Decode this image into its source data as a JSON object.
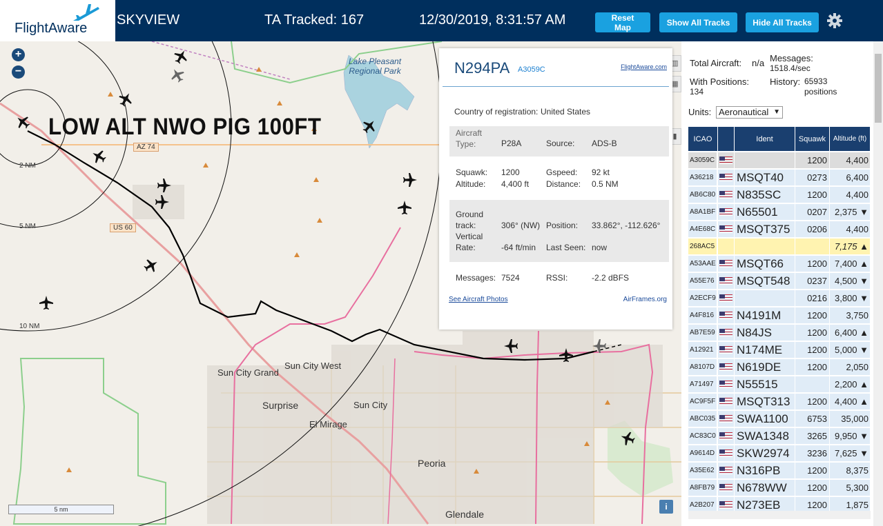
{
  "header": {
    "brand": "FlightAware",
    "app_title": "SKYVIEW",
    "tracked": "TA Tracked: 167",
    "datetime": "12/30/2019, 8:31:57 AM",
    "reset_map": "Reset Map",
    "show_all_tracks": "Show All Tracks",
    "hide_all_tracks": "Hide All Tracks",
    "settings_icon": "gear-icon"
  },
  "map": {
    "zoom_in": "+",
    "zoom_out": "−",
    "overlay_title": "LOW ALT NWO PIG 100FT",
    "scale_label": "5 nm",
    "info": "i",
    "range_rings": [
      "2 NM",
      "5 NM",
      "10 NM"
    ],
    "labels": {
      "lake": "Lake Pleasant Regional Park",
      "az74": "AZ 74",
      "us60": "US 60",
      "sun_city_west": "Sun City West",
      "sun_city_grand": "Sun City Grand",
      "surprise": "Surprise",
      "sun_city": "Sun City",
      "el_mirage": "El Mirage",
      "peoria": "Peoria",
      "glendale": "Glendale"
    },
    "colors": {
      "background": "#f2efe9",
      "track": "#000000",
      "highway": "#e8a0a0",
      "water": "#aad3df"
    }
  },
  "popup": {
    "registration": "N294PA",
    "icao": "A3059C",
    "link": "FlightAware.com",
    "country_label": "Country of registration:",
    "country": "United States",
    "aircraft_type_label": "Aircraft Type:",
    "aircraft_type": "P28A",
    "source_label": "Source:",
    "source": "ADS-B",
    "squawk_label": "Squawk:",
    "squawk": "1200",
    "gspeed_label": "Gspeed:",
    "gspeed": "92 kt",
    "altitude_label": "Altitude:",
    "altitude": "4,400 ft",
    "distance_label": "Distance:",
    "distance": "0.5 NM",
    "ground_track_label": "Ground track:",
    "ground_track": "306° (NW)",
    "position_label": "Position:",
    "position": "33.862°, -112.626°",
    "vertical_rate_label": "Vertical Rate:",
    "vertical_rate": "-64 ft/min",
    "last_seen_label": "Last Seen:",
    "last_seen": "now",
    "messages_label": "Messages:",
    "messages": "7524",
    "rssi_label": "RSSI:",
    "rssi": "-2.2 dBFS",
    "photos_link": "See Aircraft Photos",
    "airframes_link": "AirFrames.org"
  },
  "panel": {
    "total_aircraft_label": "Total Aircraft:",
    "total_aircraft": "n/a",
    "messages_label": "Messages:",
    "messages": "1518.4/sec",
    "with_positions_label": "With Positions:",
    "with_positions": "134",
    "history_label": "History:",
    "history": "65933 positions",
    "units_label": "Units:",
    "units_value": "Aeronautical",
    "columns": [
      "ICAO",
      "Ident",
      "Squawk",
      "Altitude (ft)"
    ],
    "rows": [
      {
        "icao": "A3059C",
        "ident": "",
        "squawk": "1200",
        "alt": "4,400",
        "flag": true,
        "sel": true
      },
      {
        "icao": "A36218",
        "ident": "MSQT40",
        "squawk": "0273",
        "alt": "6,400",
        "flag": true
      },
      {
        "icao": "AB6C80",
        "ident": "N835SC",
        "squawk": "1200",
        "alt": "4,400",
        "flag": true
      },
      {
        "icao": "A8A1BF",
        "ident": "N65501",
        "squawk": "0207",
        "alt": "2,375 ▼",
        "flag": true
      },
      {
        "icao": "A4E68C",
        "ident": "MSQT375",
        "squawk": "0206",
        "alt": "4,400",
        "flag": true
      },
      {
        "icao": "268AC5",
        "ident": "",
        "squawk": "",
        "alt": "7,175 ▲",
        "flag": false,
        "hl": true
      },
      {
        "icao": "A53AAE",
        "ident": "MSQT66",
        "squawk": "1200",
        "alt": "7,400 ▲",
        "flag": true
      },
      {
        "icao": "A55E76",
        "ident": "MSQT548",
        "squawk": "0237",
        "alt": "4,500 ▼",
        "flag": true
      },
      {
        "icao": "A2ECF9",
        "ident": "",
        "squawk": "0216",
        "alt": "3,800 ▼",
        "flag": true
      },
      {
        "icao": "A4F816",
        "ident": "N4191M",
        "squawk": "1200",
        "alt": "3,750",
        "flag": true
      },
      {
        "icao": "AB7E59",
        "ident": "N84JS",
        "squawk": "1200",
        "alt": "6,400 ▲",
        "flag": true
      },
      {
        "icao": "A12921",
        "ident": "N174ME",
        "squawk": "1200",
        "alt": "5,000 ▼",
        "flag": true
      },
      {
        "icao": "A8107D",
        "ident": "N619DE",
        "squawk": "1200",
        "alt": "2,050",
        "flag": true
      },
      {
        "icao": "A71497",
        "ident": "N55515",
        "squawk": "",
        "alt": "2,200 ▲",
        "flag": true
      },
      {
        "icao": "AC9F5F",
        "ident": "MSQT313",
        "squawk": "1200",
        "alt": "4,400 ▲",
        "flag": true
      },
      {
        "icao": "ABC035",
        "ident": "SWA1100",
        "squawk": "6753",
        "alt": "35,000",
        "flag": true
      },
      {
        "icao": "AC83C0",
        "ident": "SWA1348",
        "squawk": "3265",
        "alt": "9,950 ▼",
        "flag": true
      },
      {
        "icao": "A9614D",
        "ident": "SKW2974",
        "squawk": "3236",
        "alt": "7,625 ▼",
        "flag": true
      },
      {
        "icao": "A35E62",
        "ident": "N316PB",
        "squawk": "1200",
        "alt": "8,375",
        "flag": true
      },
      {
        "icao": "A8FB79",
        "ident": "N678WW",
        "squawk": "1200",
        "alt": "5,300",
        "flag": true
      },
      {
        "icao": "A2B207",
        "ident": "N273EB",
        "squawk": "1200",
        "alt": "1,875",
        "flag": true
      }
    ]
  }
}
